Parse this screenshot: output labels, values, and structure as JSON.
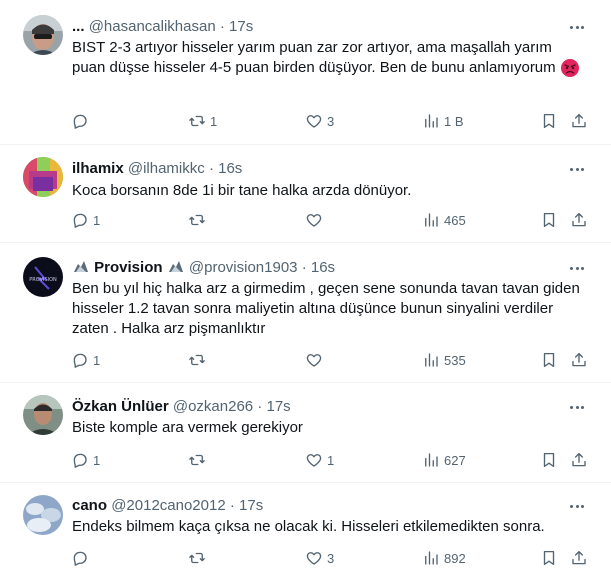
{
  "tweets": [
    {
      "name": "...",
      "handle": "@hasancalikhasan",
      "dot": "·",
      "time": "17s",
      "text": "BIST 2-3 artıyor hisseler yarım puan zar zor artıyor, ama maşallah yarım puan düşse hisseler 4-5 puan birden düşüyor. Ben de bunu anlamıyorum",
      "emoji": "angry-face",
      "replies": "",
      "retweets": "1",
      "likes": "3",
      "views": "1 B"
    },
    {
      "name": "ilhamix",
      "handle": "@ilhamikkc",
      "dot": "·",
      "time": "16s",
      "text": "Koca borsanın 8de 1i bir tane halka arzda dönüyor.",
      "replies": "1",
      "retweets": "",
      "likes": "",
      "views": "465"
    },
    {
      "name_prefix_icon": "unicorn-icon",
      "name": "Provision",
      "name_suffix_icon": "unicorn-icon",
      "handle": "@provision1903",
      "dot": "·",
      "time": "16s",
      "text": "Ben bu yıl hiç halka arz a girmedim , geçen sene sonunda tavan tavan giden hisseler 1.2 tavan sonra maliyetin altına düşünce bunun sinyalini verdiler zaten . Halka arz pişmanlıktır",
      "avatar_text": "PROVISION",
      "replies": "1",
      "retweets": "",
      "likes": "",
      "views": "535"
    },
    {
      "name": "Özkan Ünlüer",
      "handle": "@ozkan266",
      "dot": "·",
      "time": "17s",
      "text": "Biste komple ara vermek gerekiyor",
      "replies": "1",
      "retweets": "",
      "likes": "1",
      "views": "627"
    },
    {
      "name": "cano",
      "handle": "@2012cano2012",
      "dot": "·",
      "time": "17s",
      "text": "Endeks bilmem kaça çıksa ne olacak ki. Hisseleri etkilemedikten sonra.",
      "replies": "",
      "retweets": "",
      "likes": "3",
      "views": "892"
    }
  ],
  "colors": {
    "text": "#0f1419",
    "secondary": "#536471",
    "divider": "#eff3f4"
  }
}
